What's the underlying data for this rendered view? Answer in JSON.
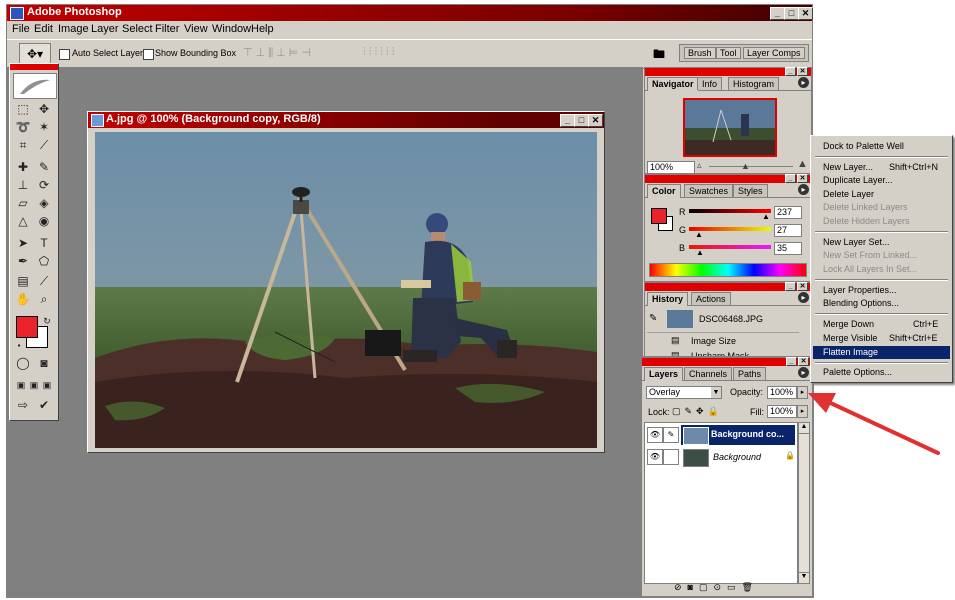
{
  "app": {
    "title": "Adobe Photoshop"
  },
  "menu": [
    "File",
    "Edit",
    "Image",
    "Layer",
    "Select",
    "Filter",
    "View",
    "Window",
    "Help"
  ],
  "options": {
    "auto_select_label": "Auto Select Layer",
    "bounding_box_label": "Show Bounding Box",
    "palette_well_tabs": [
      "Brush",
      "Tool",
      "Layer Comps"
    ]
  },
  "document": {
    "title": "A.jpg @ 100% (Background copy, RGB/8)"
  },
  "navigator": {
    "tabs": [
      "Navigator",
      "Info",
      "Histogram"
    ],
    "zoom": "100%"
  },
  "color": {
    "tabs": [
      "Color",
      "Swatches",
      "Styles"
    ],
    "r_label": "R",
    "g_label": "G",
    "b_label": "B",
    "r": "237",
    "g": "27",
    "b": "35"
  },
  "history": {
    "tabs": [
      "History",
      "Actions"
    ],
    "snapshot": "DSC06468.JPG",
    "items": [
      "Image Size",
      "Unsharp Mask"
    ]
  },
  "layers": {
    "tabs": [
      "Layers",
      "Channels",
      "Paths"
    ],
    "blend_mode": "Overlay",
    "opacity_label": "Opacity:",
    "opacity": "100%",
    "lock_label": "Lock:",
    "fill_label": "Fill:",
    "fill": "100%",
    "rows": [
      {
        "name": "Background co...",
        "selected": true
      },
      {
        "name": "Background",
        "selected": false
      }
    ]
  },
  "context_menu": {
    "items": [
      {
        "label": "Dock to Palette Well",
        "shortcut": "",
        "disabled": false
      },
      {
        "label": "New Layer...",
        "shortcut": "Shift+Ctrl+N",
        "disabled": false
      },
      {
        "label": "Duplicate Layer...",
        "shortcut": "",
        "disabled": false
      },
      {
        "label": "Delete Layer",
        "shortcut": "",
        "disabled": false
      },
      {
        "label": "Delete Linked Layers",
        "shortcut": "",
        "disabled": true
      },
      {
        "label": "Delete Hidden Layers",
        "shortcut": "",
        "disabled": true
      },
      {
        "label": "New Layer Set...",
        "shortcut": "",
        "disabled": false
      },
      {
        "label": "New Set From Linked...",
        "shortcut": "",
        "disabled": true
      },
      {
        "label": "Lock All Layers In Set...",
        "shortcut": "",
        "disabled": true
      },
      {
        "label": "Layer Properties...",
        "shortcut": "",
        "disabled": false
      },
      {
        "label": "Blending Options...",
        "shortcut": "",
        "disabled": false
      },
      {
        "label": "Merge Down",
        "shortcut": "Ctrl+E",
        "disabled": false
      },
      {
        "label": "Merge Visible",
        "shortcut": "Shift+Ctrl+E",
        "disabled": false
      },
      {
        "label": "Flatten Image",
        "shortcut": "",
        "disabled": false,
        "highlighted": true
      },
      {
        "label": "Palette Options...",
        "shortcut": "",
        "disabled": false
      }
    ]
  },
  "colors": {
    "accent_red": "#e00000",
    "selection_blue": "#0a246a",
    "arrow_red": "#e03030",
    "foreground": "#e8242a"
  }
}
